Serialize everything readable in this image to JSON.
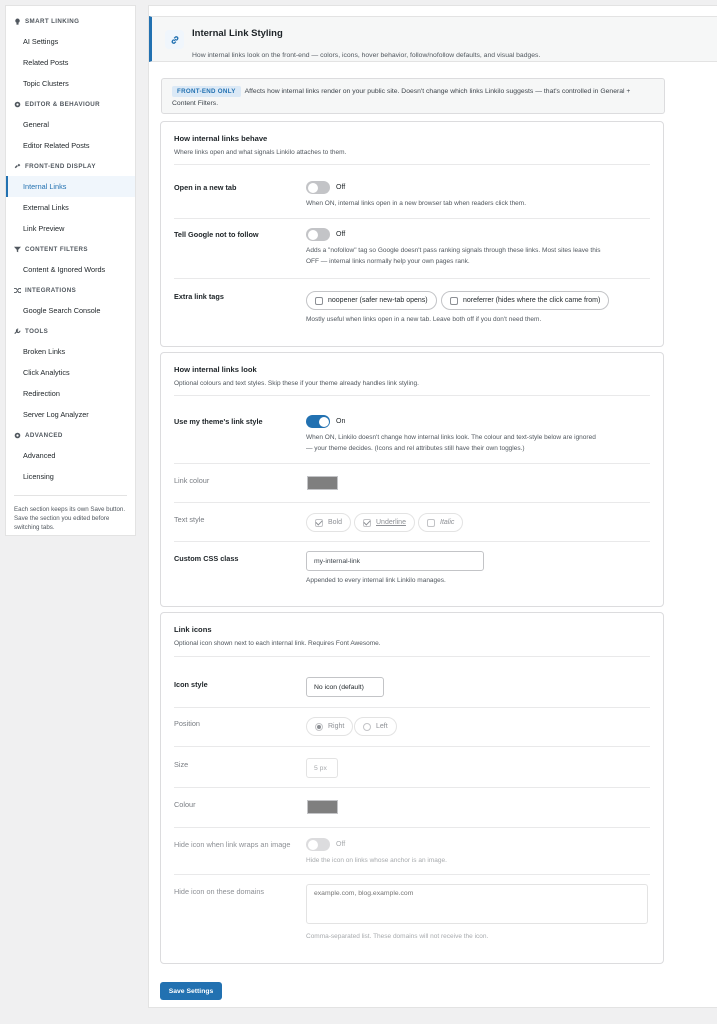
{
  "sidebar": {
    "sections": [
      {
        "title": "SMART LINKING",
        "icon": "bulb-icon",
        "items": [
          "AI Settings",
          "Related Posts",
          "Topic Clusters"
        ]
      },
      {
        "title": "EDITOR & BEHAVIOUR",
        "icon": "gear-icon",
        "items": [
          "General",
          "Editor Related Posts"
        ]
      },
      {
        "title": "FRONT-END DISPLAY",
        "icon": "link-icon",
        "items": [
          "Internal Links",
          "External Links",
          "Link Preview"
        ]
      },
      {
        "title": "CONTENT FILTERS",
        "icon": "filter-icon",
        "items": [
          "Content & Ignored Words"
        ]
      },
      {
        "title": "INTEGRATIONS",
        "icon": "shuffle-icon",
        "items": [
          "Google Search Console"
        ]
      },
      {
        "title": "TOOLS",
        "icon": "wrench-icon",
        "items": [
          "Broken Links",
          "Click Analytics",
          "Redirection",
          "Server Log Analyzer"
        ]
      },
      {
        "title": "ADVANCED",
        "icon": "gear-icon",
        "items": [
          "Advanced",
          "Licensing"
        ]
      }
    ],
    "active_item": "Internal Links",
    "note": "Each section keeps its own Save button. Save the section you edited before switching tabs."
  },
  "header": {
    "title": "Internal Link Styling",
    "subtitle": "How internal links look on the front-end — colors, icons, hover behavior, follow/nofollow defaults, and visual badges."
  },
  "notice": {
    "badge": "FRONT-END ONLY",
    "text": "Affects how internal links render on your public site. Doesn't change which links Linkilo suggests — that's controlled in General + Content Filters."
  },
  "behave": {
    "title": "How internal links behave",
    "subtitle": "Where links open and what signals Linkilo attaches to them.",
    "new_tab": {
      "label": "Open in a new tab",
      "state": "Off",
      "desc": "When ON, internal links open in a new browser tab when readers click them."
    },
    "nofollow": {
      "label": "Tell Google not to follow",
      "state": "Off",
      "desc": "Adds a \"nofollow\" tag so Google doesn't pass ranking signals through these links. Most sites leave this OFF — internal links normally help your own pages rank."
    },
    "extra": {
      "label": "Extra link tags",
      "opt1": "noopener (safer new-tab opens)",
      "opt2": "noreferrer (hides where the click came from)",
      "desc": "Mostly useful when links open in a new tab. Leave both off if you don't need them."
    }
  },
  "look": {
    "title": "How internal links look",
    "subtitle": "Optional colours and text styles. Skip these if your theme already handles link styling.",
    "theme": {
      "label": "Use my theme's link style",
      "state": "On",
      "desc": "When ON, Linkilo doesn't change how internal links look. The colour and text-style below are ignored — your theme decides. (Icons and rel attributes still have their own toggles.)"
    },
    "colour": {
      "label": "Link colour",
      "value": "#7f7f7f"
    },
    "text_style": {
      "label": "Text style",
      "bold": "Bold",
      "underline": "Underline",
      "italic": "Italic"
    },
    "css_class": {
      "label": "Custom CSS class",
      "value": "my-internal-link",
      "desc": "Appended to every internal link Linkilo manages."
    }
  },
  "icons": {
    "title": "Link icons",
    "subtitle": "Optional icon shown next to each internal link. Requires Font Awesome.",
    "style": {
      "label": "Icon style",
      "value": "No icon (default)"
    },
    "position": {
      "label": "Position",
      "right": "Right",
      "left": "Left"
    },
    "size": {
      "label": "Size",
      "value": "5 px"
    },
    "colour": {
      "label": "Colour",
      "value": "#7f7f7f"
    },
    "hide_image": {
      "label": "Hide icon when link wraps an image",
      "state": "Off",
      "desc": "Hide the icon on links whose anchor is an image."
    },
    "hide_domains": {
      "label": "Hide icon on these domains",
      "placeholder": "example.com, blog.example.com",
      "desc": "Comma-separated list. These domains will not receive the icon."
    }
  },
  "save_label": "Save Settings"
}
